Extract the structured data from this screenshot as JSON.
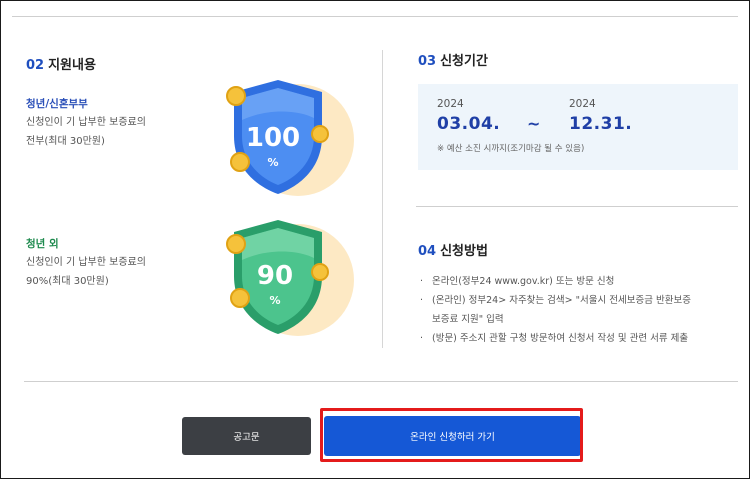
{
  "support": {
    "num": "02",
    "title": "지원내용",
    "items": [
      {
        "category": "청년/신혼부부",
        "desc1": "신청인이 기 납부한 보증료의",
        "desc2": "전부(최대 30만원)",
        "badge_value": "100",
        "badge_unit": "%",
        "color": "#2a62d6"
      },
      {
        "category": "청년 외",
        "desc1": "신청인이 기 납부한 보증료의",
        "desc2": "90%(최대 30만원)",
        "badge_value": "90",
        "badge_unit": "%",
        "color": "#1e8f5a"
      }
    ]
  },
  "period": {
    "num": "03",
    "title": "신청기간",
    "start_year": "2024",
    "start_date": "03.04.",
    "separator": "~",
    "end_year": "2024",
    "end_date": "12.31.",
    "note": "※ 예산 소진 시까지(조기마감 될 수 있음)"
  },
  "method": {
    "num": "04",
    "title": "신청방법",
    "bullet": "·",
    "items": [
      "온라인(정부24 www.gov.kr) 또는 방문 신청",
      "(온라인) 정부24> 자주찾는 검색> \"서울시 전세보증금 반환보증",
      "보증료 지원\" 입력",
      "(방문) 주소지 관할 구청 방문하여 신청서 작성 및 관련 서류 제출"
    ]
  },
  "buttons": {
    "notice": "공고문",
    "apply": "온라인 신청하러 가기"
  },
  "colors": {
    "accent_blue": "#1f4fbf",
    "apply_button": "#1558d6",
    "notice_button": "#3c3f44",
    "highlight": "#e41b1b"
  }
}
